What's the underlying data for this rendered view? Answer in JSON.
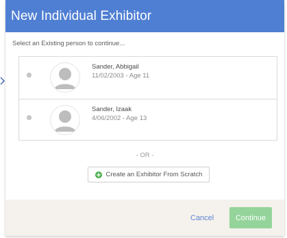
{
  "dialog": {
    "title": "New Individual Exhibitor",
    "instruction": "Select an Existing person to continue..."
  },
  "people": [
    {
      "name": "Sander, Abbigail",
      "dob_age": "11/02/2003 - Age 11",
      "icon": "person-silhouette-icon"
    },
    {
      "name": "Sander, Izaak",
      "dob_age": "4/06/2002 - Age 13",
      "icon": "person-silhouette-icon"
    }
  ],
  "divider_text": "- OR -",
  "create_button": {
    "label": "Create an Exhibitor From Scratch",
    "icon": "plus-circle-icon"
  },
  "footer": {
    "cancel_label": "Cancel",
    "continue_label": "Continue"
  },
  "colors": {
    "header": "#4f7fd3",
    "link": "#5c86d4",
    "continue": "#94d49b",
    "plus_icon": "#4caf50",
    "footer_bg": "#f5f1ec"
  }
}
